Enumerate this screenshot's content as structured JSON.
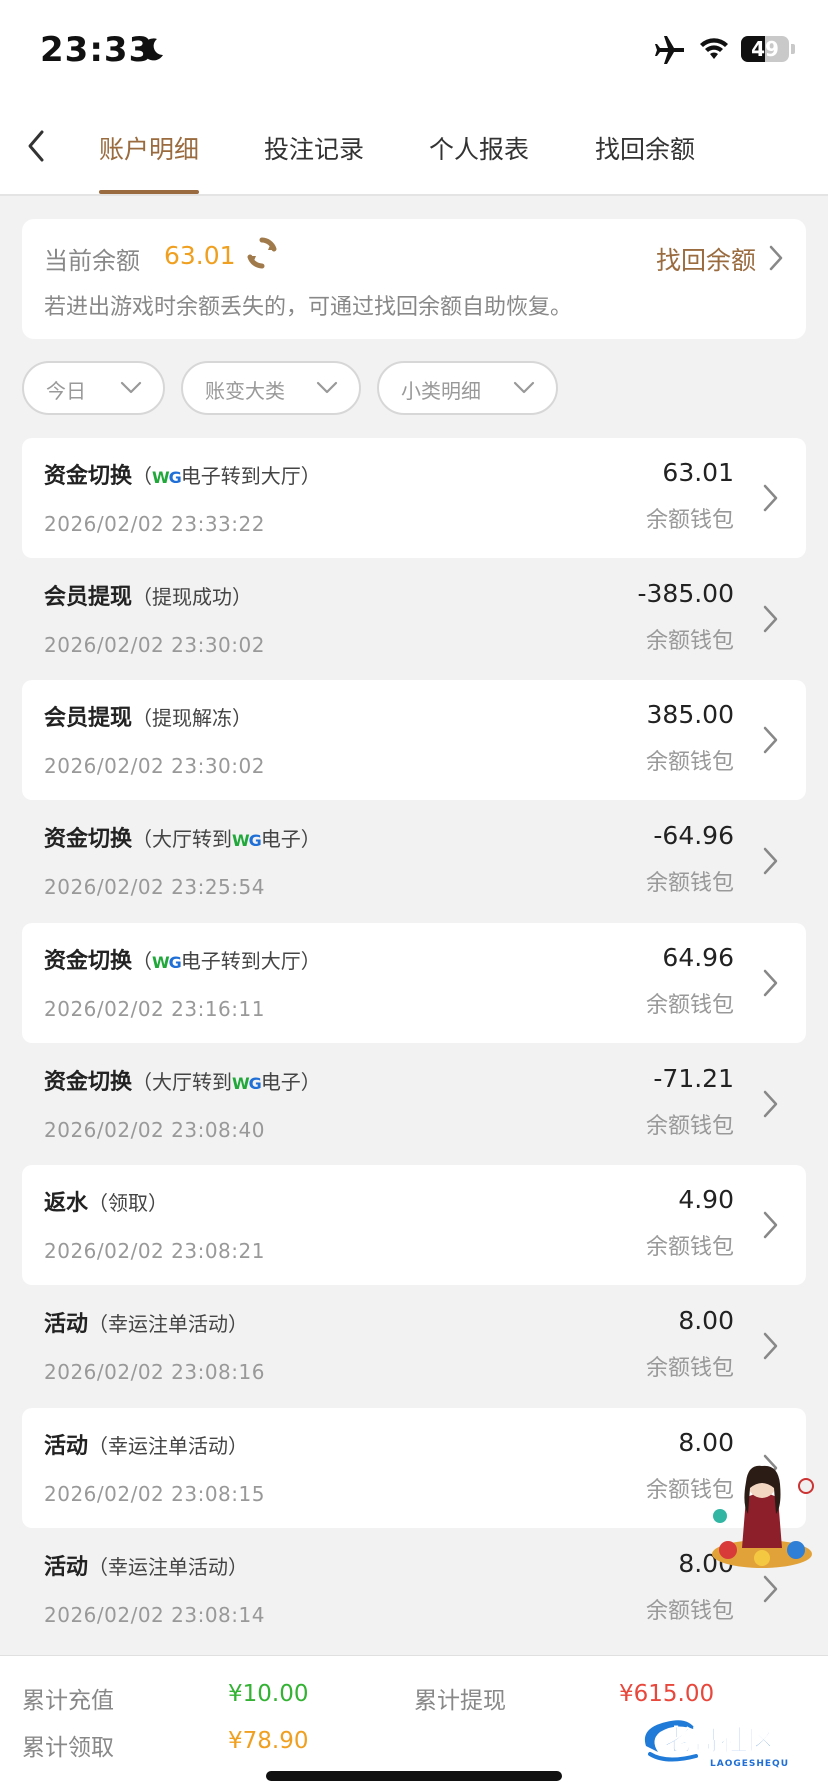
{
  "status_bar": {
    "time": "23:33",
    "battery": "49",
    "battery_level": 0.49,
    "icons": [
      "moon-icon",
      "airplane-icon",
      "wifi-icon",
      "battery-icon"
    ]
  },
  "nav": {
    "tabs": [
      {
        "label": "账户明细",
        "active": true
      },
      {
        "label": "投注记录",
        "active": false
      },
      {
        "label": "个人报表",
        "active": false
      },
      {
        "label": "找回余额",
        "active": false
      }
    ],
    "accent_color": "#9a6b3f"
  },
  "balance": {
    "label": "当前余额",
    "value": "63.01",
    "recover_label": "找回余额",
    "hint": "若进出游戏时余额丢失的，可通过找回余额自助恢复。"
  },
  "filters": [
    {
      "label": "今日"
    },
    {
      "label": "账变大类"
    },
    {
      "label": "小类明细"
    }
  ],
  "transactions": [
    {
      "type": "资金切换",
      "open": "（",
      "sub_a": "",
      "brand": "WG",
      "sub_b": "电子转到大厅）",
      "date": "2026/02/02 23:33:22",
      "amount": "63.01",
      "wallet": "余额钱包"
    },
    {
      "type": "会员提现",
      "open": "",
      "sub_a": "（提现成功）",
      "brand": "",
      "sub_b": "",
      "date": "2026/02/02 23:30:02",
      "amount": "-385.00",
      "wallet": "余额钱包"
    },
    {
      "type": "会员提现",
      "open": "",
      "sub_a": "（提现解冻）",
      "brand": "",
      "sub_b": "",
      "date": "2026/02/02 23:30:02",
      "amount": "385.00",
      "wallet": "余额钱包"
    },
    {
      "type": "资金切换",
      "open": "",
      "sub_a": "（大厅转到",
      "brand": "WG",
      "sub_b": "电子）",
      "date": "2026/02/02 23:25:54",
      "amount": "-64.96",
      "wallet": "余额钱包"
    },
    {
      "type": "资金切换",
      "open": "（",
      "sub_a": "",
      "brand": "WG",
      "sub_b": "电子转到大厅）",
      "date": "2026/02/02 23:16:11",
      "amount": "64.96",
      "wallet": "余额钱包"
    },
    {
      "type": "资金切换",
      "open": "",
      "sub_a": "（大厅转到",
      "brand": "WG",
      "sub_b": "电子）",
      "date": "2026/02/02 23:08:40",
      "amount": "-71.21",
      "wallet": "余额钱包"
    },
    {
      "type": "返水",
      "open": "",
      "sub_a": "（领取）",
      "brand": "",
      "sub_b": "",
      "date": "2026/02/02 23:08:21",
      "amount": "4.90",
      "wallet": "余额钱包"
    },
    {
      "type": "活动",
      "open": "",
      "sub_a": "（幸运注单活动）",
      "brand": "",
      "sub_b": "",
      "date": "2026/02/02 23:08:16",
      "amount": "8.00",
      "wallet": "余额钱包"
    },
    {
      "type": "活动",
      "open": "",
      "sub_a": "（幸运注单活动）",
      "brand": "",
      "sub_b": "",
      "date": "2026/02/02 23:08:15",
      "amount": "8.00",
      "wallet": "余额钱包"
    },
    {
      "type": "活动",
      "open": "",
      "sub_a": "（幸运注单活动）",
      "brand": "",
      "sub_b": "",
      "date": "2026/02/02 23:08:14",
      "amount": "8.00",
      "wallet": "余额钱包"
    }
  ],
  "summary": {
    "recharge_label": "累计充值",
    "recharge_value": "¥10.00",
    "withdraw_label": "累计提现",
    "withdraw_value": "¥615.00",
    "claim_label": "累计领取",
    "claim_value": "¥78.90",
    "colors": {
      "recharge": "#33b233",
      "withdraw": "#e8473c",
      "claim": "#f0a020"
    }
  },
  "watermark": {
    "title": "老哥社区",
    "subtitle": "LAOGESHEQU"
  }
}
